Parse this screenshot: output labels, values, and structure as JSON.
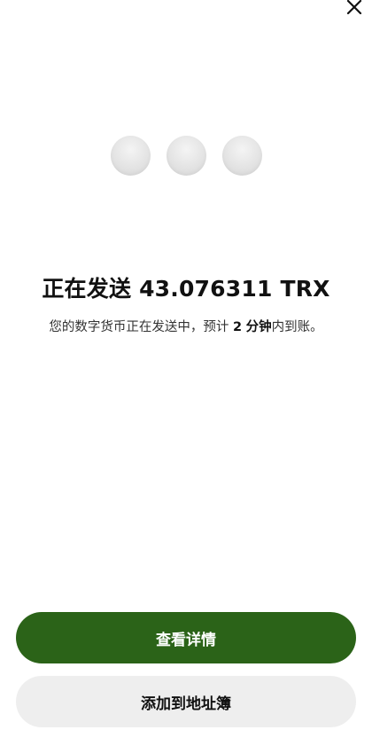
{
  "header": {
    "close_icon": "close-icon"
  },
  "status": {
    "title_prefix": "正在发送",
    "amount": "43.076311",
    "currency": "TRX",
    "subtitle_before": "您的数字货币正在发送中，预计",
    "eta_value": "2",
    "eta_unit": "分钟",
    "subtitle_after": "内到账。"
  },
  "actions": {
    "view_details_label": "查看详情",
    "add_to_address_book_label": "添加到地址簿"
  },
  "colors": {
    "primary": "#2b6318",
    "secondary_bg": "#eeeeee",
    "loader_dot": "#e2e2e2"
  }
}
